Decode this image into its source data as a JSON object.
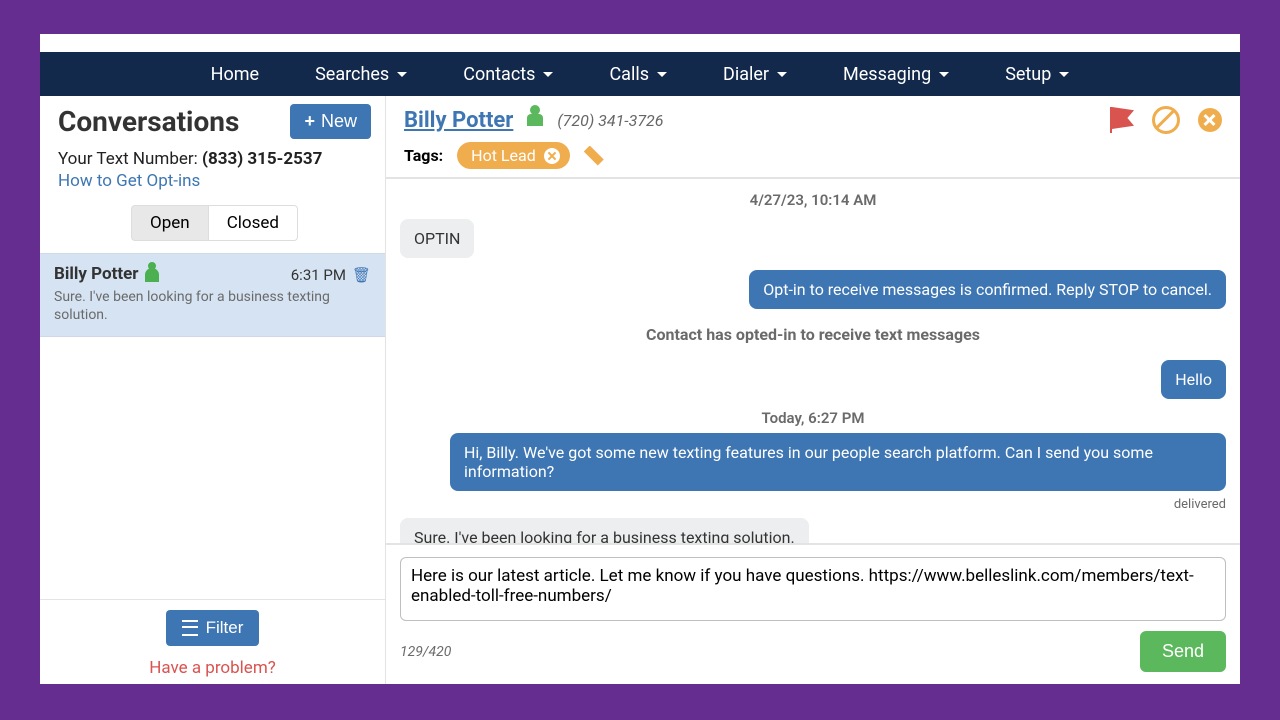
{
  "nav": {
    "items": [
      "Home",
      "Searches",
      "Contacts",
      "Calls",
      "Dialer",
      "Messaging",
      "Setup"
    ]
  },
  "sidebar": {
    "title": "Conversations",
    "new_btn": "New",
    "text_number_label": "Your Text Number: ",
    "text_number": "(833) 315-2537",
    "optins_link": "How to Get Opt-ins",
    "tab_open": "Open",
    "tab_closed": "Closed",
    "item": {
      "name": "Billy Potter",
      "time": "6:31 PM",
      "preview": "Sure. I've been looking for a business texting solution."
    },
    "filter_btn": "Filter",
    "problem_link": "Have a problem?"
  },
  "chat": {
    "contact_name": "Billy Potter",
    "phone": "(720) 341-3726",
    "tags_label": "Tags:",
    "tag1": "Hot Lead",
    "ts1": "4/27/23, 10:14 AM",
    "msg_optin": "OPTIN",
    "msg_optin_confirm": "Opt-in to receive messages is confirmed. Reply STOP to cancel.",
    "sys_optin": "Contact has opted-in to receive text messages",
    "msg_hello": "Hello",
    "ts2": "Today, 6:27 PM",
    "msg_pitch": "Hi, Billy. We've got some new texting features in our people search platform. Can I send you some information?",
    "delivered": "delivered",
    "msg_reply": "Sure. I've been looking for a business texting solution.",
    "compose_text": "Here is our latest article. Let me know if you have questions. https://www.belleslink.com/members/text-enabled-toll-free-numbers/",
    "char_count": "129/420",
    "send_btn": "Send"
  }
}
